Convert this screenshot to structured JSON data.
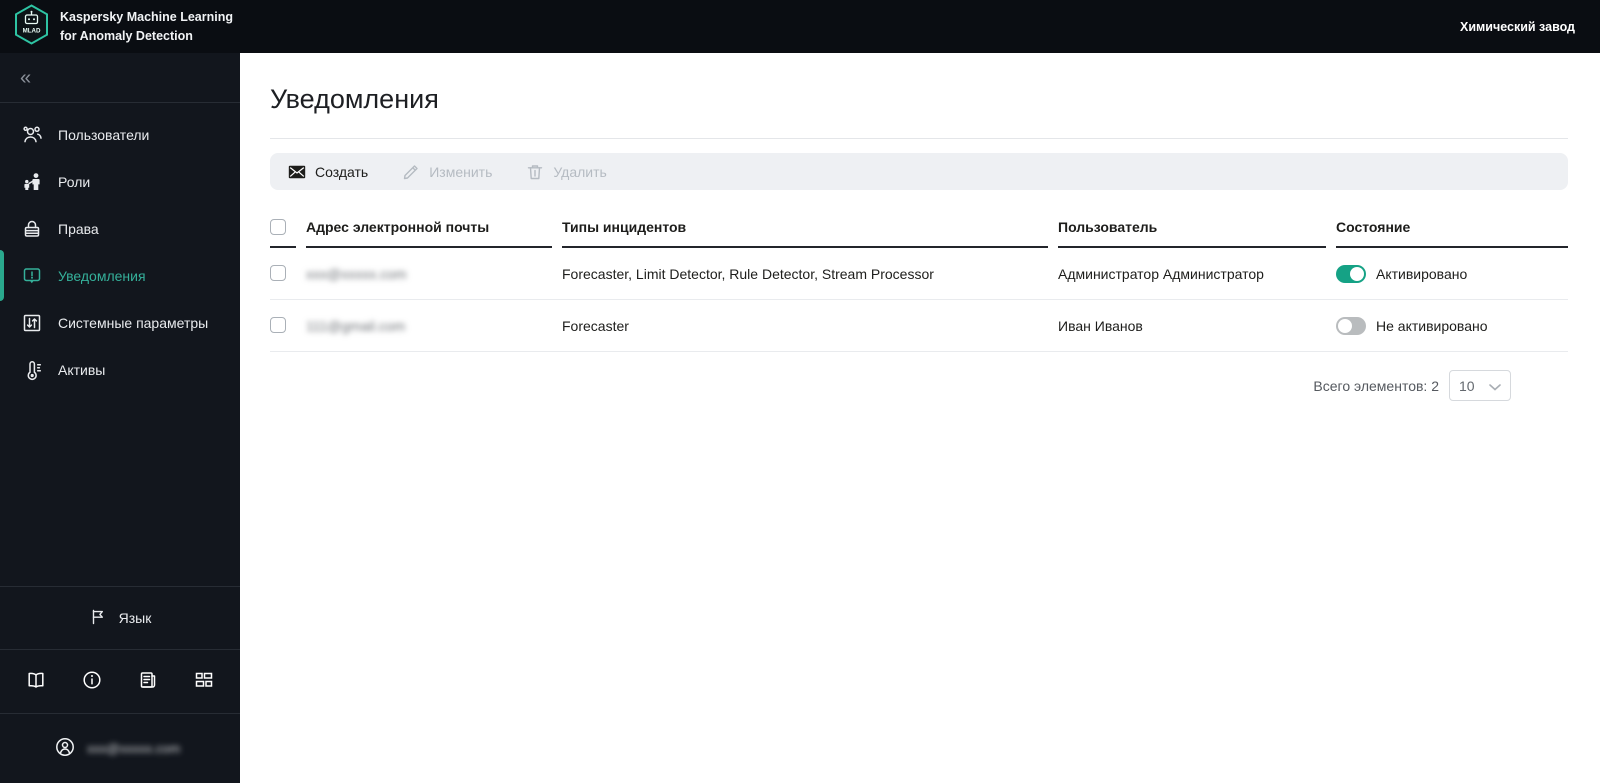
{
  "colors": {
    "accent_teal": "#2aa98e",
    "toggle_on": "#15a285",
    "topbar_bg": "#0a0d12",
    "sidebar_bg": "#12161d",
    "toolbar_bg": "#eef0f3"
  },
  "topbar": {
    "logo_text": "MLAD",
    "app_title": "Kaspersky Machine Learning for Anomaly Detection",
    "tenant": "Химический завод"
  },
  "sidebar": {
    "collapse_label": "«",
    "items": [
      {
        "label": "Пользователи",
        "icon": "users-icon",
        "active": false
      },
      {
        "label": "Роли",
        "icon": "roles-icon",
        "active": false
      },
      {
        "label": "Права",
        "icon": "lock-icon",
        "active": false
      },
      {
        "label": "Уведомления",
        "icon": "notification-bubble-icon",
        "active": true
      },
      {
        "label": "Системные параметры",
        "icon": "system-parameters-icon",
        "active": false
      },
      {
        "label": "Активы",
        "icon": "thermometer-icon",
        "active": false
      }
    ],
    "language_label": "Язык",
    "footer_icons": [
      "book-icon",
      "info-icon",
      "journal-icon",
      "widgets-icon"
    ],
    "user_email_redacted": "xxx@xxxxx.com"
  },
  "main": {
    "page_title": "Уведомления",
    "toolbar": {
      "create_label": "Создать",
      "edit_label": "Изменить",
      "delete_label": "Удалить"
    },
    "table": {
      "columns": [
        "Адрес электронной почты",
        "Типы инцидентов",
        "Пользователь",
        "Состояние"
      ],
      "rows": [
        {
          "email_redacted": "xxx@xxxxx.com",
          "incident_types": "Forecaster, Limit Detector, Rule Detector, Stream Processor",
          "user": "Администратор Администратор",
          "state_label": "Активировано",
          "state_on": true
        },
        {
          "email_redacted": "111@gmail.com",
          "incident_types": "Forecaster",
          "user": "Иван Иванов",
          "state_label": "Не активировано",
          "state_on": false
        }
      ]
    },
    "pagination": {
      "total_label": "Всего элементов: 2",
      "page_size": "10"
    }
  }
}
